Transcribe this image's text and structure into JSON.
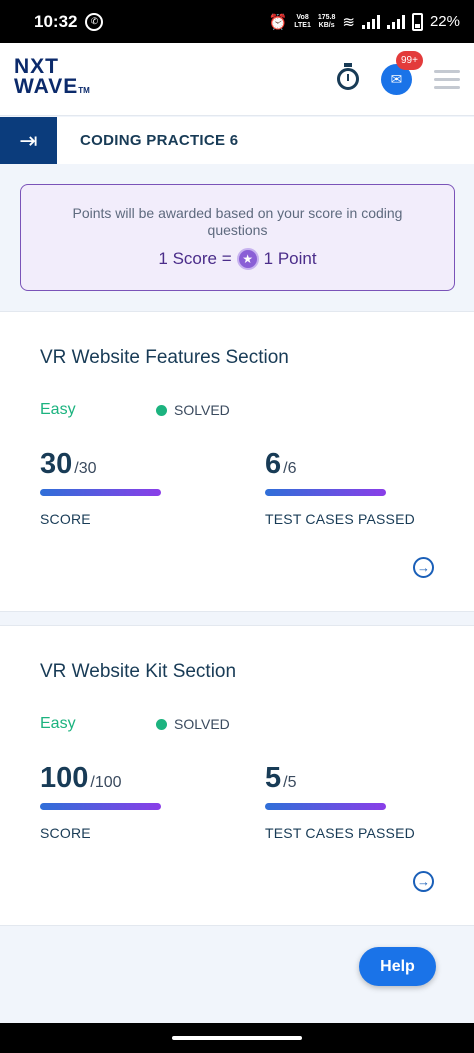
{
  "status_bar": {
    "time": "10:32",
    "net_label_top": "Vo8",
    "net_label_bottom": "LTE1",
    "speed_top": "175.8",
    "speed_bottom": "KB/s",
    "battery": "22%"
  },
  "app": {
    "logo_top": "NXT",
    "logo_bottom": "WAVE",
    "logo_tm": "TM",
    "notification_count": "99+"
  },
  "page": {
    "title": "CODING PRACTICE 6"
  },
  "points_info": {
    "note": "Points will be awarded based on your score in coding questions",
    "score_text": "1 Score =",
    "point_text": "1 Point"
  },
  "questions": [
    {
      "title": "VR Website Features Section",
      "difficulty": "Easy",
      "status": "SOLVED",
      "score": "30",
      "score_max": "/30",
      "score_label": "SCORE",
      "tests": "6",
      "tests_max": "/6",
      "tests_label": "TEST CASES PASSED"
    },
    {
      "title": "VR Website Kit Section",
      "difficulty": "Easy",
      "status": "SOLVED",
      "score": "100",
      "score_max": "/100",
      "score_label": "SCORE",
      "tests": "5",
      "tests_max": "/5",
      "tests_label": "TEST CASES PASSED"
    }
  ],
  "help": {
    "label": "Help"
  },
  "colors": {
    "primary": "#1a73e8",
    "easy": "#1cb37f",
    "dark": "#183b56",
    "accent_purple": "#7a53b8"
  }
}
